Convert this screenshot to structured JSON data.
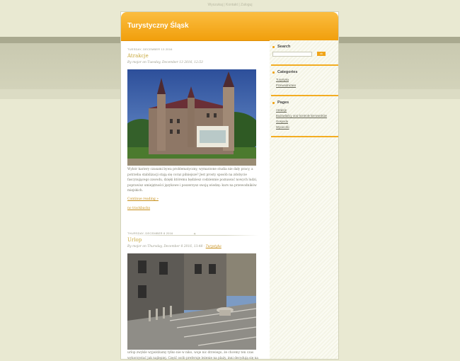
{
  "top_links": {
    "link1": "Wyszukaj",
    "sep1": "|",
    "link2": "Kontakt",
    "sep2": "|",
    "link3": "Zaloguj"
  },
  "blog": {
    "title": "Turystyczny Śląsk"
  },
  "posts": [
    {
      "date": "Tuesday, December 13 2016",
      "title": "Atrakcje",
      "meta": "By mojor on Tuesday, December 13 2016, 12:53",
      "body": "Wybór kariery czasami bywa problematyczny, wymarzone studia nie dały pracy, a potrzeba stabilizacji stają się coraz pilniejsze? Jest prosty sposób na zdobycie fascynującego zawodu, dzięki któremu będziesz codziennie poznawać nowych ludzi, poprawisz umiejętności językowe i poszerzysz swoją wiedzę: kurs na przewodników miejskich.",
      "continue": "Continue reading »",
      "trackback": "no trackbacks"
    },
    {
      "date": "Thursday, December 8 2016",
      "title": "Urlop",
      "meta_prefix": "By mojor on Thursday, December 8 2016, 13:48 -",
      "meta_label": "Turystyka",
      "body": "urlop zwykle wyjeżdżamy tylko nie w niko, woje nic drzwiego, że chcemy ten czas wykorzystać jak najlepiej. Część osób preferuje leżenie na plaży, inni decydują się na"
    }
  ],
  "sidebar": {
    "search": {
      "title": "Search",
      "button": "ok"
    },
    "categories": {
      "title": "Categories",
      "items": [
        "Turystyka",
        "Przewodnictwo"
      ]
    },
    "pages": {
      "title": "Pages",
      "items": [
        "Atrakcje",
        "Budowlańcy oraz kontrole kierowników",
        "Gospoda",
        "Wycieczki"
      ]
    }
  },
  "colors": {
    "header": "#f3a617",
    "accent": "#c78f1a",
    "background": "#e9e9d2"
  }
}
